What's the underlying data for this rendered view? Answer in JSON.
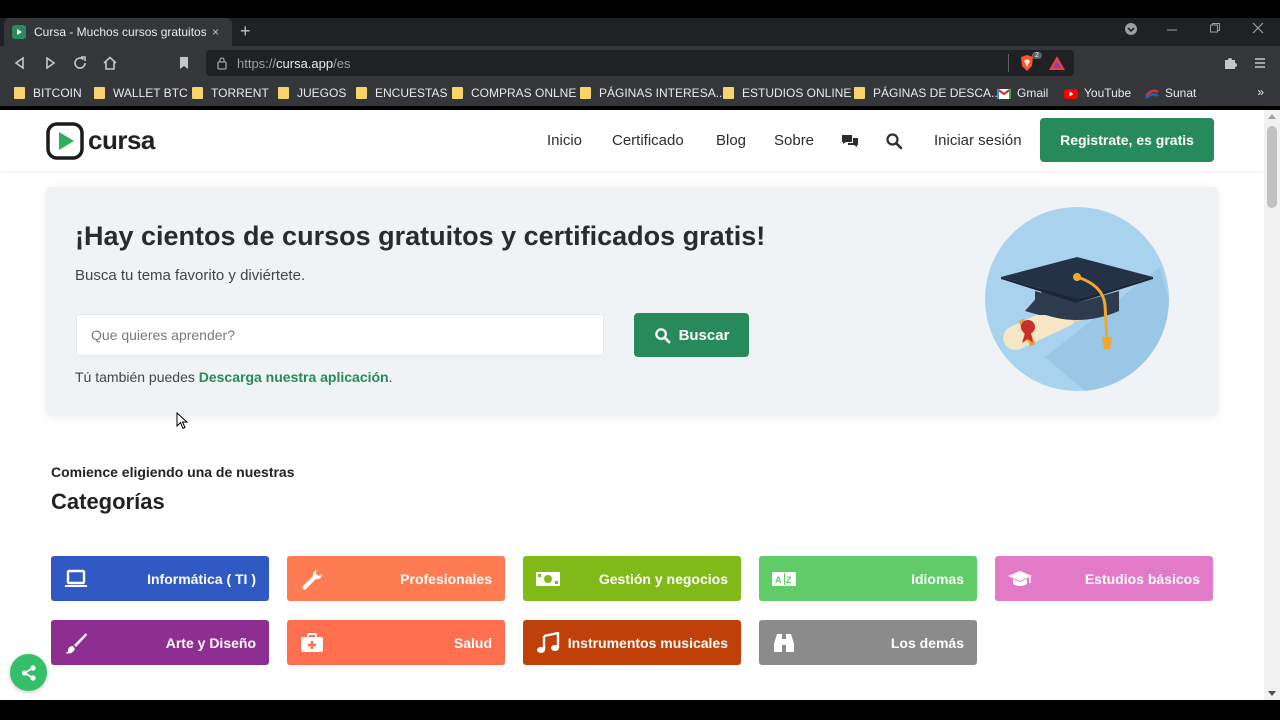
{
  "browser": {
    "tab_title": "Cursa - Muchos cursos gratuitos p",
    "tab_close": "×",
    "new_tab": "+",
    "url_prefix": "https://",
    "url_host": "cursa.app",
    "url_path": "/es",
    "extension_badge": "2",
    "bookmarks": [
      {
        "label": "BITCOIN",
        "icon": "folder-icon"
      },
      {
        "label": "WALLET BTC",
        "icon": "folder-icon"
      },
      {
        "label": "TORRENT",
        "icon": "folder-icon"
      },
      {
        "label": "JUEGOS",
        "icon": "folder-icon"
      },
      {
        "label": "ENCUESTAS",
        "icon": "folder-icon"
      },
      {
        "label": "COMPRAS ONLNE",
        "icon": "folder-icon"
      },
      {
        "label": "PÁGINAS INTERESA...",
        "icon": "folder-icon"
      },
      {
        "label": "ESTUDIOS ONLINE",
        "icon": "folder-icon"
      },
      {
        "label": "PÁGINAS DE DESCA...",
        "icon": "folder-icon"
      },
      {
        "label": "Gmail",
        "icon": "gmail-icon"
      },
      {
        "label": "YouTube",
        "icon": "youtube-icon"
      },
      {
        "label": "Sunat",
        "icon": "sunat-icon"
      }
    ],
    "bookmarks_more": "»"
  },
  "site": {
    "logo_text": "cursa",
    "nav": {
      "home": "Inicio",
      "certificate": "Certificado",
      "blog": "Blog",
      "about": "Sobre",
      "login": "Iniciar sesión",
      "register": "Registrate, es gratis"
    }
  },
  "hero": {
    "title": "¡Hay cientos de cursos gratuitos y certificados gratis!",
    "subtitle": "Busca tu tema favorito y diviértete.",
    "search_placeholder": "Que quieres aprender?",
    "search_button": "Buscar",
    "app_prefix": "Tú también puedes ",
    "app_link": "Descarga nuestra aplicación",
    "app_suffix": "."
  },
  "categories": {
    "intro": "Comience eligiendo una de nuestras",
    "heading": "Categorías",
    "items": [
      {
        "label": "Informática ( TI )",
        "icon": "laptop-icon",
        "color": "#3059c4"
      },
      {
        "label": "Profesionales",
        "icon": "wrench-icon",
        "color": "#ff7c52"
      },
      {
        "label": "Gestión y negocios",
        "icon": "money-icon",
        "color": "#80b918"
      },
      {
        "label": "Idiomas",
        "icon": "language-icon",
        "color": "#5fcc68"
      },
      {
        "label": "Estudios básicos",
        "icon": "graduation-cap-icon",
        "color": "#e27ac8"
      },
      {
        "label": "Arte y Diseño",
        "icon": "paintbrush-icon",
        "color": "#8e2e91"
      },
      {
        "label": "Salud",
        "icon": "medkit-icon",
        "color": "#ff6f4f"
      },
      {
        "label": "Instrumentos musicales",
        "icon": "music-icon",
        "color": "#bf4009"
      },
      {
        "label": "Los demás",
        "icon": "binoculars-icon",
        "color": "#8b8b8b"
      }
    ]
  },
  "colors": {
    "brand_green": "#278a5a",
    "share_green": "#34c06a",
    "hero_bg": "#eff3f6"
  }
}
